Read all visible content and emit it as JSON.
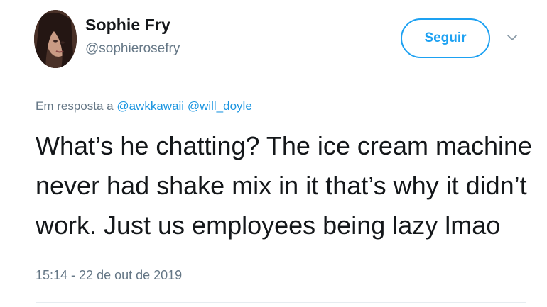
{
  "user": {
    "display_name": "Sophie Fry",
    "handle": "@sophierosefry"
  },
  "follow_button": {
    "label": "Seguir"
  },
  "reply": {
    "prefix": "Em resposta a",
    "mentions": [
      "@awkkawaii",
      "@will_doyle"
    ]
  },
  "tweet": {
    "lines": [
      "What’s he chatting? The ice cream machine",
      "never had shake mix in it that’s why it didn’t",
      "work. Just us employees being lazy lmao"
    ]
  },
  "timestamp": "15:14 - 22 de out de 2019",
  "colors": {
    "accent": "#1da1f2",
    "mention": "#1b95e0",
    "secondary_text": "#657786",
    "primary_text": "#14171a"
  },
  "icons": {
    "avatar": "profile-photo",
    "caret": "chevron-down-icon"
  }
}
